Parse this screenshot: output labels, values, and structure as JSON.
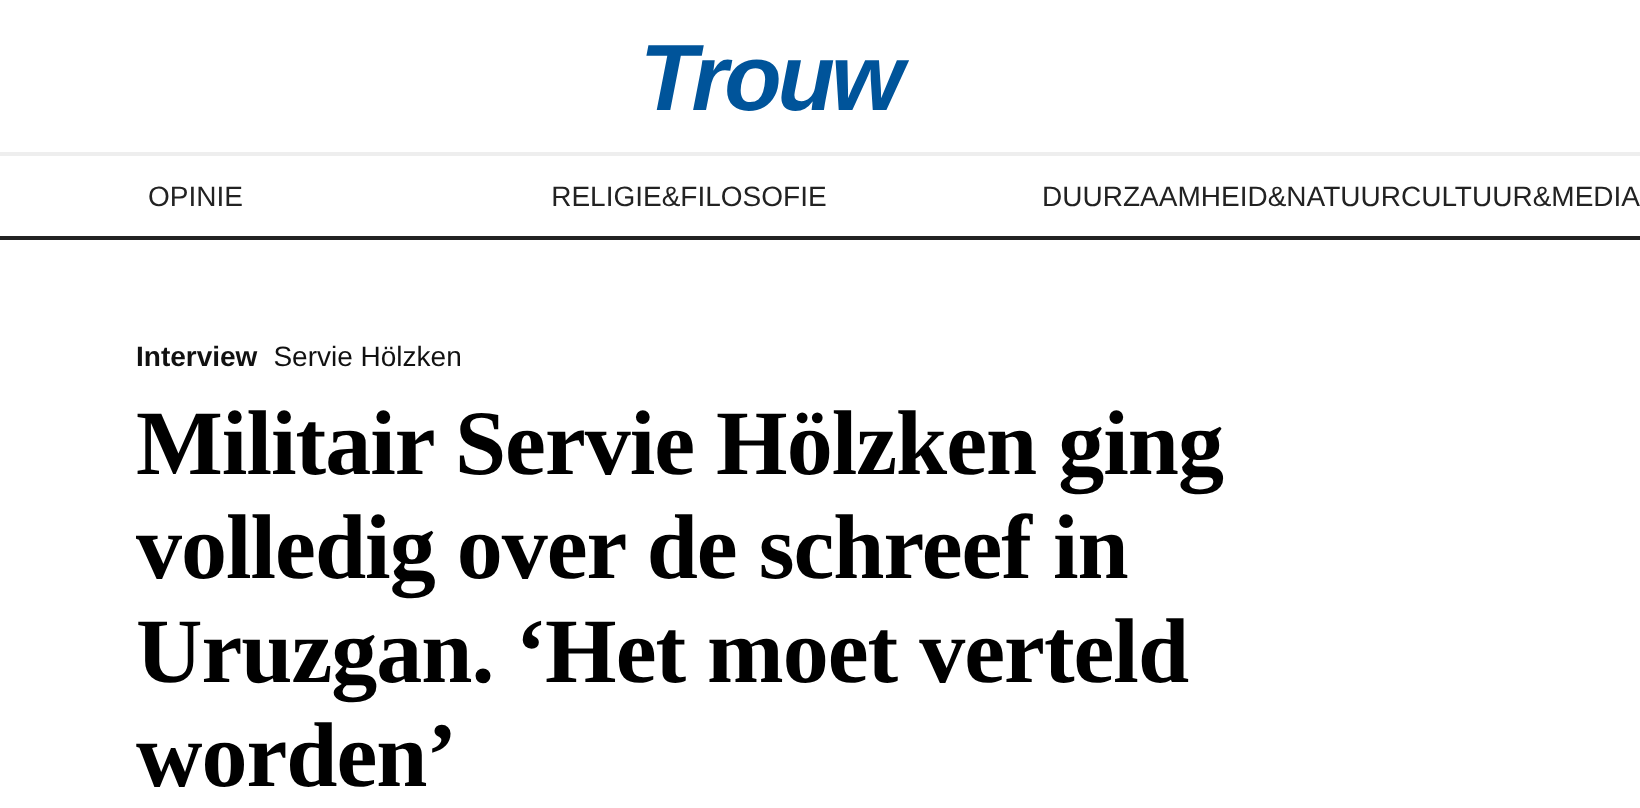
{
  "logo": "Trouw",
  "nav": [
    {
      "label": "OPINIE"
    },
    {
      "label": "RELIGIE&FILOSOFIE"
    },
    {
      "label": "DUURZAAMHEID&NATUUR"
    },
    {
      "label": "CULTUUR&MEDIA"
    }
  ],
  "article": {
    "category": "Interview",
    "tag": "Servie Hölzken",
    "headline": "Militair Servie Hölzken ging volledig over de schreef in Uruzgan. ‘Het moet verteld worden’"
  }
}
